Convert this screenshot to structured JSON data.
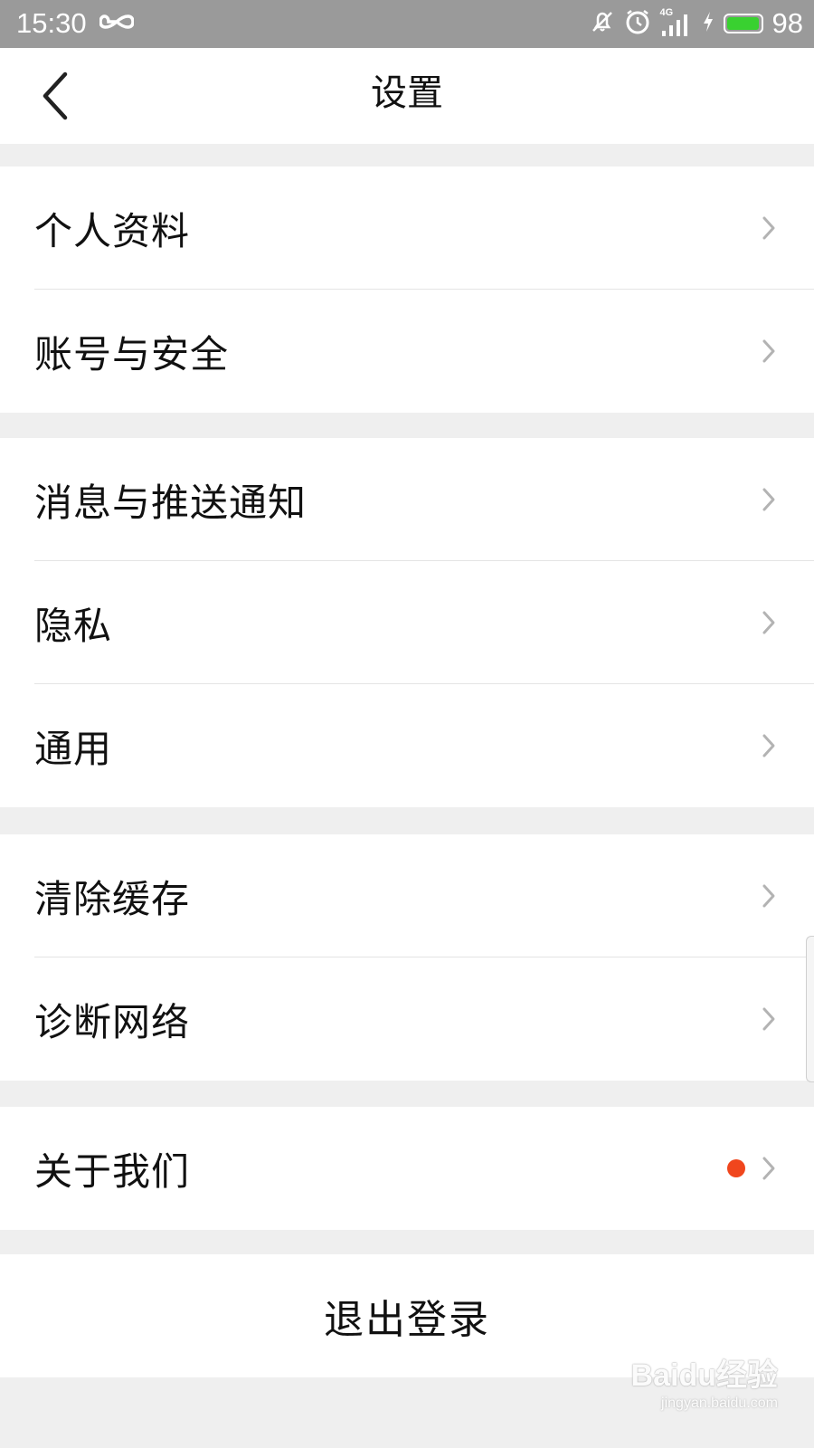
{
  "status_bar": {
    "time": "15:30",
    "battery": "98",
    "battery_level_percent": 98,
    "battery_color": "#39d130",
    "icons": [
      "infinity-icon",
      "mute-icon",
      "alarm-icon",
      "signal-4g-icon",
      "charging-icon",
      "battery-icon"
    ],
    "network": "4G"
  },
  "header": {
    "title": "设置",
    "back_icon": "chevron-left-icon"
  },
  "groups": [
    {
      "items": [
        {
          "label": "个人资料"
        },
        {
          "label": "账号与安全"
        }
      ]
    },
    {
      "items": [
        {
          "label": "消息与推送通知"
        },
        {
          "label": "隐私"
        },
        {
          "label": "通用"
        }
      ]
    },
    {
      "items": [
        {
          "label": "清除缓存"
        },
        {
          "label": "诊断网络"
        }
      ]
    },
    {
      "items": [
        {
          "label": "关于我们",
          "badge": "red-dot"
        }
      ]
    }
  ],
  "logout": {
    "label": "退出登录"
  },
  "colors": {
    "badge": "#f0461d",
    "chevron": "#b3b3b3",
    "background": "#efefef"
  },
  "watermark": {
    "logo": "Baidu经验",
    "url": "jingyan.baidu.com"
  }
}
